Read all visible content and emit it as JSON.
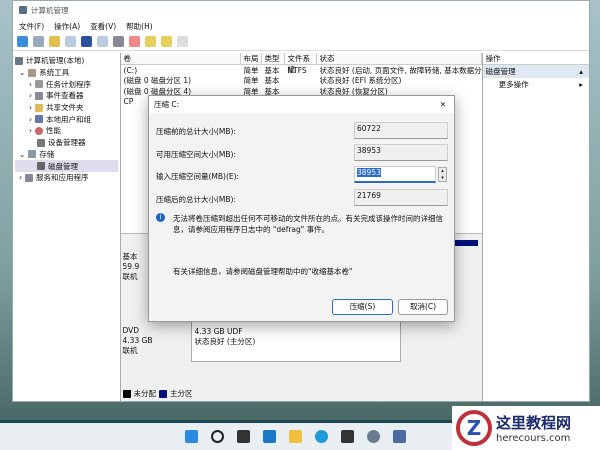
{
  "window": {
    "title": "计算机管理"
  },
  "menu": [
    "文件(F)",
    "操作(A)",
    "查看(V)",
    "帮助(H)"
  ],
  "tree": [
    {
      "label": "计算机管理(本地)",
      "level": 0
    },
    {
      "label": "系统工具",
      "level": 1
    },
    {
      "label": "任务计划程序",
      "level": 2
    },
    {
      "label": "事件查看器",
      "level": 2
    },
    {
      "label": "共享文件夹",
      "level": 2
    },
    {
      "label": "本地用户和组",
      "level": 2
    },
    {
      "label": "性能",
      "level": 2
    },
    {
      "label": "设备管理器",
      "level": 2
    },
    {
      "label": "存储",
      "level": 1
    },
    {
      "label": "磁盘管理",
      "level": 2
    },
    {
      "label": "服务和应用程序",
      "level": 1
    }
  ],
  "volumes": {
    "headers": [
      "卷",
      "布局",
      "类型",
      "文件系统",
      "状态"
    ],
    "rows": [
      [
        "(C:)",
        "简单",
        "基本",
        "NTFS",
        "状态良好 (启动, 页面文件, 故障转储, 基本数据分"
      ],
      [
        "(磁盘 0 磁盘分区 1)",
        "简单",
        "基本",
        "",
        "状态良好 (EFI 系统分区)"
      ],
      [
        "(磁盘 0 磁盘分区 4)",
        "简单",
        "基本",
        "",
        "状态良好 (恢复分区)"
      ],
      [
        "CP",
        "",
        "",
        "",
        ""
      ]
    ]
  },
  "actions": {
    "header": "操作",
    "section": "磁盘管理",
    "more": "更多操作"
  },
  "disks": {
    "disk0": {
      "l1": "基本",
      "l2": "59.9",
      "l3": "联机"
    },
    "cd": {
      "l1": "DVD",
      "l2": "4.33 GB",
      "l3": "联机",
      "p1": "4.33 GB UDF",
      "p2": "状态良好 (主分区)"
    },
    "legend": [
      "未分配",
      "主分区"
    ]
  },
  "dialog": {
    "title": "压缩 C:",
    "fields": [
      {
        "label": "压缩前的总计大小(MB):",
        "value": "60722"
      },
      {
        "label": "可用压缩空间大小(MB):",
        "value": "38953"
      },
      {
        "label": "输入压缩空间量(MB)(E):",
        "value": "38953"
      },
      {
        "label": "压缩后的总计大小(MB):",
        "value": "21769"
      }
    ],
    "info": "无法将卷压缩到超出任何不可移动的文件所在的点。有关完成该操作时间的详细信息，请参阅应用程序日志中的 \"defrag\" 事件。",
    "help": "有关详细信息，请参阅磁盘管理帮助中的\"收缩基本卷\"",
    "ok": "压缩(S)",
    "cancel": "取消(C)"
  },
  "watermark": {
    "name": "这里教程网",
    "url": "herecours.com"
  }
}
